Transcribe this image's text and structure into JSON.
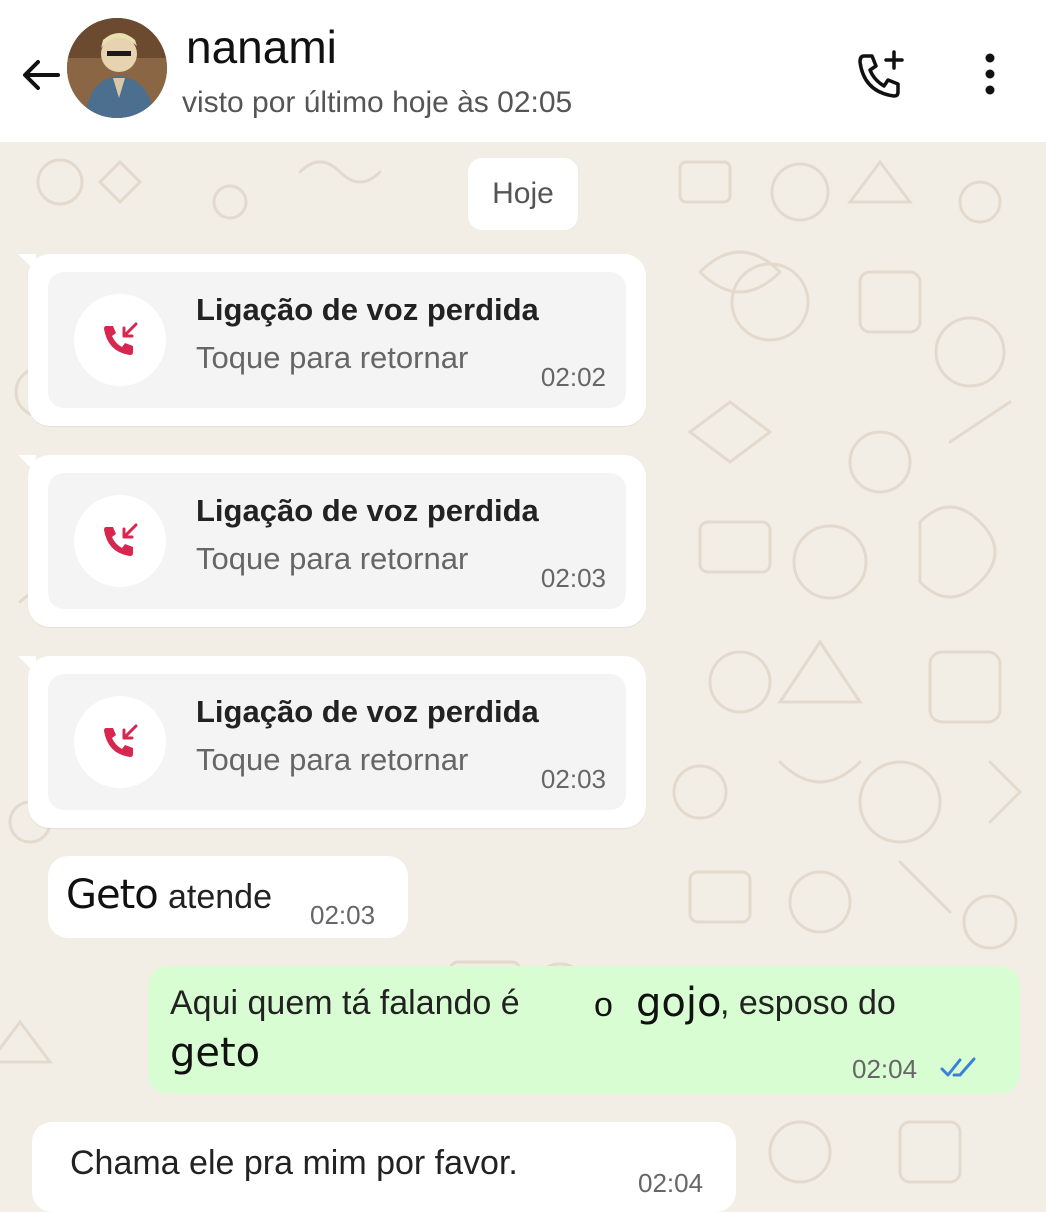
{
  "header": {
    "contact_name": "nanami",
    "last_seen": "visto por último hoje às 02:05",
    "icons": [
      "back-arrow-icon",
      "add-call-icon",
      "more-vert-icon"
    ]
  },
  "date_chip": "Hoje",
  "missed_calls": [
    {
      "title": "Ligação de voz perdida",
      "subtitle": "Toque para retornar",
      "time": "02:02"
    },
    {
      "title": "Ligação de voz perdida",
      "subtitle": "Toque para retornar",
      "time": "02:03"
    },
    {
      "title": "Ligação de voz perdida",
      "subtitle": "Toque para retornar",
      "time": "02:03"
    }
  ],
  "messages": [
    {
      "direction": "in",
      "word1": "Geto",
      "word2": "atende",
      "time": "02:03"
    },
    {
      "direction": "out",
      "part1": "Aqui quem tá falando é",
      "part2": "o",
      "part3": "gojo",
      "part4": ", esposo do",
      "part5": "geto",
      "time": "02:04",
      "status_icon": "double-check-read-icon"
    },
    {
      "direction": "in",
      "text": "Chama ele pra mim por favor.",
      "time": "02:04"
    }
  ],
  "colors": {
    "outgoing_bubble": "#d9fdd3",
    "missed_call_red": "#d7264f",
    "read_check_blue": "#3b82d6",
    "wallpaper": "#f2ede5"
  }
}
